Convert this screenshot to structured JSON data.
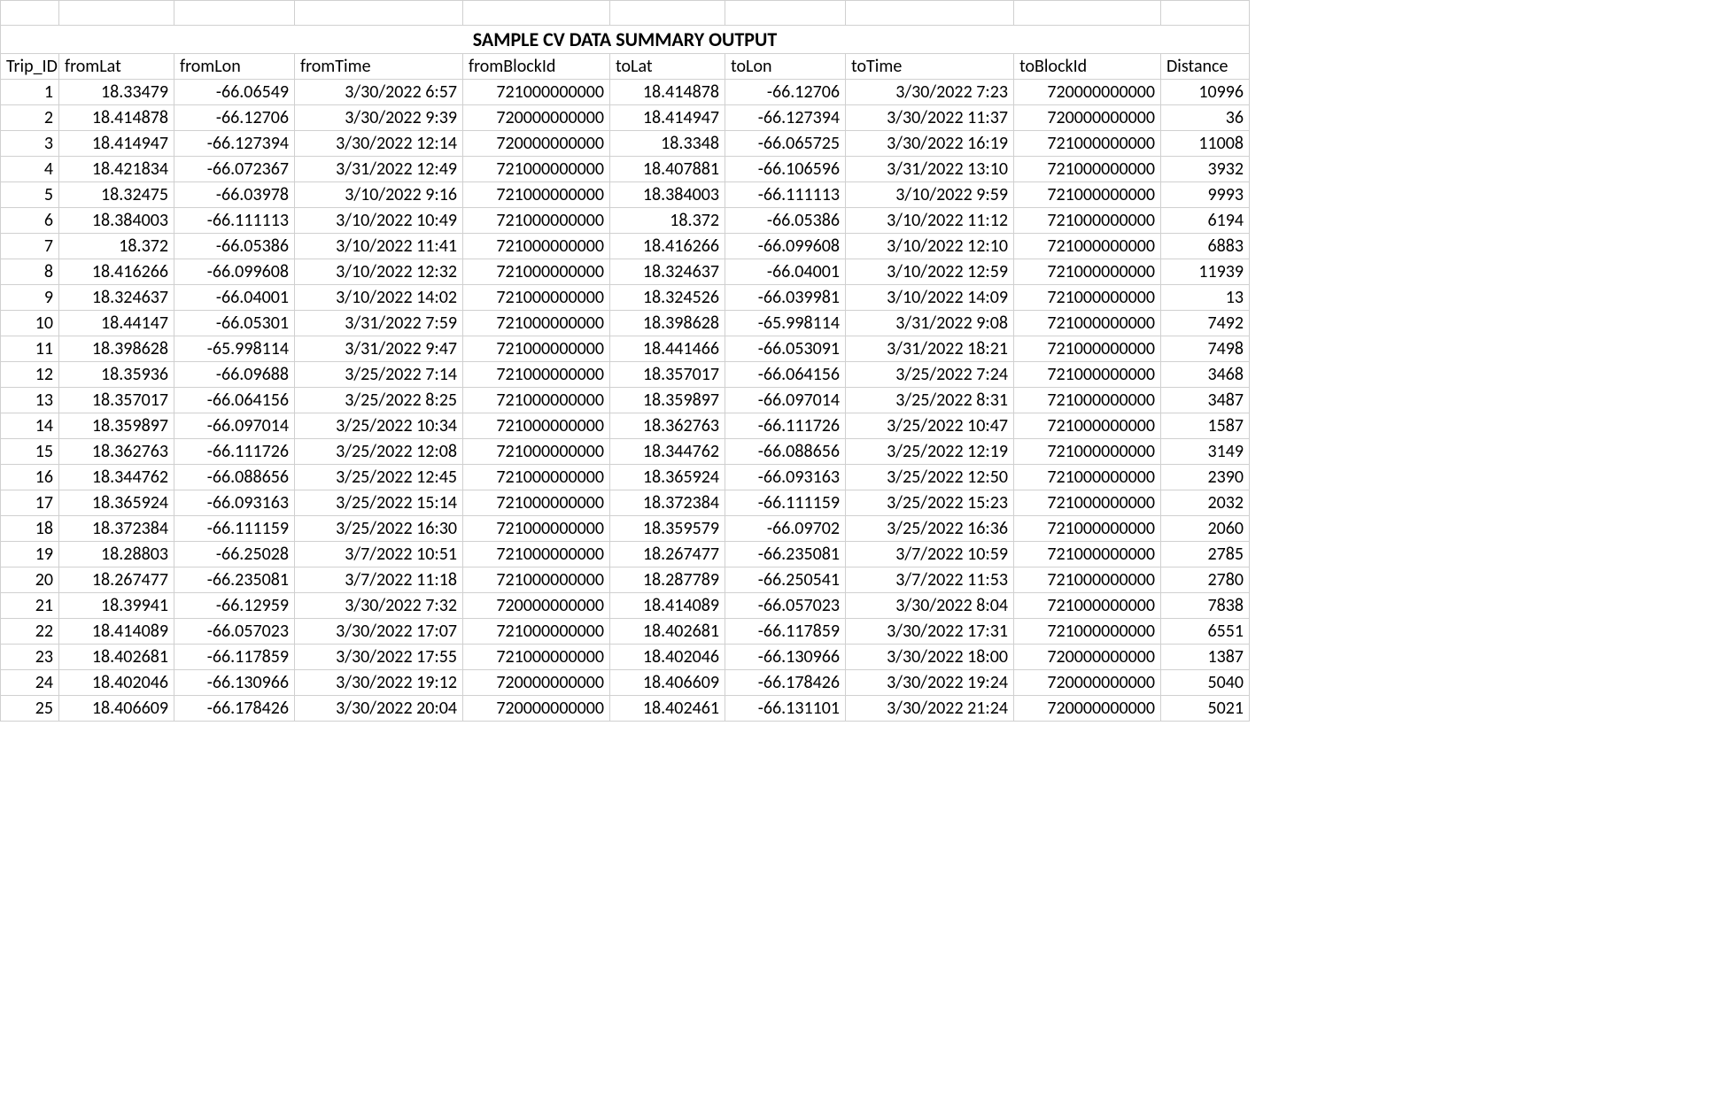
{
  "title": "SAMPLE CV DATA SUMMARY OUTPUT",
  "chart_data": {
    "type": "table",
    "columns": [
      "Trip_ID",
      "fromLat",
      "fromLon",
      "fromTime",
      "fromBlockId",
      "toLat",
      "toLon",
      "toTime",
      "toBlockId",
      "Distance"
    ],
    "rows": [
      [
        "1",
        "18.33479",
        "-66.06549",
        "3/30/2022 6:57",
        "721000000000",
        "18.414878",
        "-66.12706",
        "3/30/2022 7:23",
        "720000000000",
        "10996"
      ],
      [
        "2",
        "18.414878",
        "-66.12706",
        "3/30/2022 9:39",
        "720000000000",
        "18.414947",
        "-66.127394",
        "3/30/2022 11:37",
        "720000000000",
        "36"
      ],
      [
        "3",
        "18.414947",
        "-66.127394",
        "3/30/2022 12:14",
        "720000000000",
        "18.3348",
        "-66.065725",
        "3/30/2022 16:19",
        "721000000000",
        "11008"
      ],
      [
        "4",
        "18.421834",
        "-66.072367",
        "3/31/2022 12:49",
        "721000000000",
        "18.407881",
        "-66.106596",
        "3/31/2022 13:10",
        "721000000000",
        "3932"
      ],
      [
        "5",
        "18.32475",
        "-66.03978",
        "3/10/2022 9:16",
        "721000000000",
        "18.384003",
        "-66.111113",
        "3/10/2022 9:59",
        "721000000000",
        "9993"
      ],
      [
        "6",
        "18.384003",
        "-66.111113",
        "3/10/2022 10:49",
        "721000000000",
        "18.372",
        "-66.05386",
        "3/10/2022 11:12",
        "721000000000",
        "6194"
      ],
      [
        "7",
        "18.372",
        "-66.05386",
        "3/10/2022 11:41",
        "721000000000",
        "18.416266",
        "-66.099608",
        "3/10/2022 12:10",
        "721000000000",
        "6883"
      ],
      [
        "8",
        "18.416266",
        "-66.099608",
        "3/10/2022 12:32",
        "721000000000",
        "18.324637",
        "-66.04001",
        "3/10/2022 12:59",
        "721000000000",
        "11939"
      ],
      [
        "9",
        "18.324637",
        "-66.04001",
        "3/10/2022 14:02",
        "721000000000",
        "18.324526",
        "-66.039981",
        "3/10/2022 14:09",
        "721000000000",
        "13"
      ],
      [
        "10",
        "18.44147",
        "-66.05301",
        "3/31/2022 7:59",
        "721000000000",
        "18.398628",
        "-65.998114",
        "3/31/2022 9:08",
        "721000000000",
        "7492"
      ],
      [
        "11",
        "18.398628",
        "-65.998114",
        "3/31/2022 9:47",
        "721000000000",
        "18.441466",
        "-66.053091",
        "3/31/2022 18:21",
        "721000000000",
        "7498"
      ],
      [
        "12",
        "18.35936",
        "-66.09688",
        "3/25/2022 7:14",
        "721000000000",
        "18.357017",
        "-66.064156",
        "3/25/2022 7:24",
        "721000000000",
        "3468"
      ],
      [
        "13",
        "18.357017",
        "-66.064156",
        "3/25/2022 8:25",
        "721000000000",
        "18.359897",
        "-66.097014",
        "3/25/2022 8:31",
        "721000000000",
        "3487"
      ],
      [
        "14",
        "18.359897",
        "-66.097014",
        "3/25/2022 10:34",
        "721000000000",
        "18.362763",
        "-66.111726",
        "3/25/2022 10:47",
        "721000000000",
        "1587"
      ],
      [
        "15",
        "18.362763",
        "-66.111726",
        "3/25/2022 12:08",
        "721000000000",
        "18.344762",
        "-66.088656",
        "3/25/2022 12:19",
        "721000000000",
        "3149"
      ],
      [
        "16",
        "18.344762",
        "-66.088656",
        "3/25/2022 12:45",
        "721000000000",
        "18.365924",
        "-66.093163",
        "3/25/2022 12:50",
        "721000000000",
        "2390"
      ],
      [
        "17",
        "18.365924",
        "-66.093163",
        "3/25/2022 15:14",
        "721000000000",
        "18.372384",
        "-66.111159",
        "3/25/2022 15:23",
        "721000000000",
        "2032"
      ],
      [
        "18",
        "18.372384",
        "-66.111159",
        "3/25/2022 16:30",
        "721000000000",
        "18.359579",
        "-66.09702",
        "3/25/2022 16:36",
        "721000000000",
        "2060"
      ],
      [
        "19",
        "18.28803",
        "-66.25028",
        "3/7/2022 10:51",
        "721000000000",
        "18.267477",
        "-66.235081",
        "3/7/2022 10:59",
        "721000000000",
        "2785"
      ],
      [
        "20",
        "18.267477",
        "-66.235081",
        "3/7/2022 11:18",
        "721000000000",
        "18.287789",
        "-66.250541",
        "3/7/2022 11:53",
        "721000000000",
        "2780"
      ],
      [
        "21",
        "18.39941",
        "-66.12959",
        "3/30/2022 7:32",
        "720000000000",
        "18.414089",
        "-66.057023",
        "3/30/2022 8:04",
        "721000000000",
        "7838"
      ],
      [
        "22",
        "18.414089",
        "-66.057023",
        "3/30/2022 17:07",
        "721000000000",
        "18.402681",
        "-66.117859",
        "3/30/2022 17:31",
        "721000000000",
        "6551"
      ],
      [
        "23",
        "18.402681",
        "-66.117859",
        "3/30/2022 17:55",
        "721000000000",
        "18.402046",
        "-66.130966",
        "3/30/2022 18:00",
        "720000000000",
        "1387"
      ],
      [
        "24",
        "18.402046",
        "-66.130966",
        "3/30/2022 19:12",
        "720000000000",
        "18.406609",
        "-66.178426",
        "3/30/2022 19:24",
        "720000000000",
        "5040"
      ],
      [
        "25",
        "18.406609",
        "-66.178426",
        "3/30/2022 20:04",
        "720000000000",
        "18.402461",
        "-66.131101",
        "3/30/2022 21:24",
        "720000000000",
        "5021"
      ]
    ]
  }
}
